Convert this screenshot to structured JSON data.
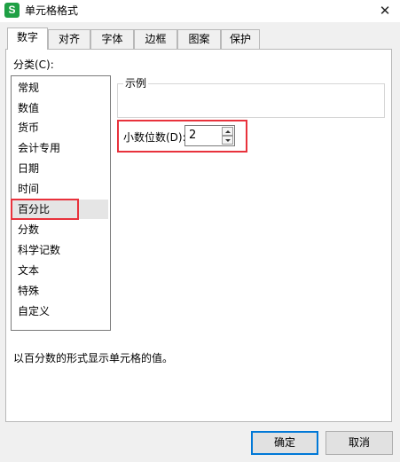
{
  "window": {
    "app_icon_letter": "S",
    "title": "单元格格式",
    "close_glyph": "✕",
    "accent_color": "#0078d7",
    "highlight_color": "#e8323c"
  },
  "tabs": [
    {
      "label": "数字",
      "active": true
    },
    {
      "label": "对齐",
      "active": false
    },
    {
      "label": "字体",
      "active": false
    },
    {
      "label": "边框",
      "active": false
    },
    {
      "label": "图案",
      "active": false
    },
    {
      "label": "保护",
      "active": false
    }
  ],
  "category": {
    "label": "分类(C):",
    "items": [
      "常规",
      "数值",
      "货币",
      "会计专用",
      "日期",
      "时间",
      "百分比",
      "分数",
      "科学记数",
      "文本",
      "特殊",
      "自定义"
    ],
    "selected": "百分比"
  },
  "sample": {
    "legend": "示例",
    "value": ""
  },
  "decimal_places": {
    "label": "小数位数(D):",
    "value": "2"
  },
  "description": "以百分数的形式显示单元格的值。",
  "buttons": {
    "ok": "确定",
    "cancel": "取消"
  }
}
